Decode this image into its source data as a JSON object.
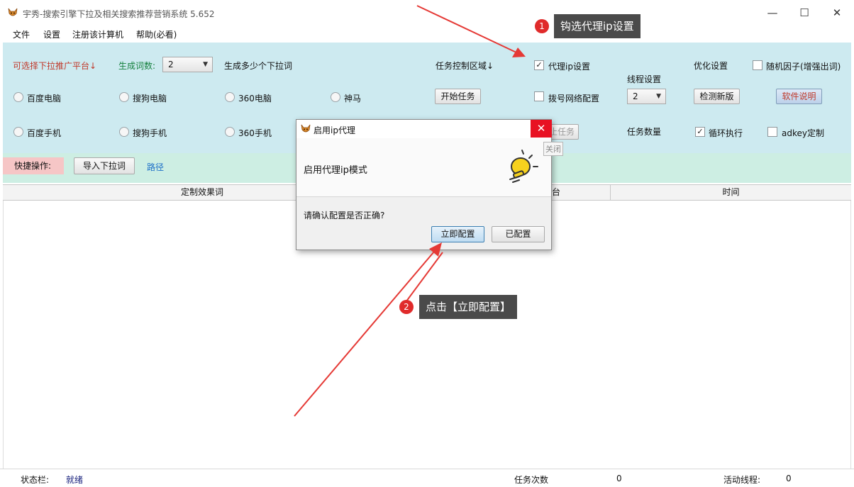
{
  "window": {
    "title": "宇秀-搜索引擎下拉及相关搜索推荐营销系统 5.652",
    "minimize": "—",
    "maximize": "☐",
    "close": "✕"
  },
  "menu": [
    "文件",
    "设置",
    "注册该计算机",
    "帮助(必看)"
  ],
  "panel": {
    "platform_label": "可选择下拉推广平台↓",
    "word_count_label": "生成词数:",
    "word_count_value": "2",
    "word_count_hint": "生成多少个下拉词",
    "task_area_label": "任务控制区域↓",
    "proxy_ip_label": "代理ip设置",
    "proxy_ip_checked": true,
    "thread_label": "线程设置",
    "thread_value": "2",
    "optimize_label": "优化设置",
    "random_factor_label": "随机因子(增强出词)",
    "random_factor_checked": false,
    "platforms_row1": [
      "百度电脑",
      "搜狗电脑",
      "360电脑",
      "神马"
    ],
    "platforms_row2": [
      "百度手机",
      "搜狗手机",
      "360手机"
    ],
    "start_task": "开始任务",
    "stop_task_partial": "止任务",
    "dialup_label": "拨号网络配置",
    "dialup_checked": false,
    "check_version": "检测新版",
    "software_help": "软件说明",
    "task_count_label": "任务数量",
    "loop_label": "循环执行",
    "loop_checked": true,
    "adkey_label": "adkey定制",
    "adkey_checked": false
  },
  "quick": {
    "label": "快捷操作:",
    "import_button": "导入下拉词",
    "path_link": "路径"
  },
  "table": {
    "columns": [
      "定制效果词",
      "台",
      "时间"
    ]
  },
  "status": {
    "label": "状态栏:",
    "value": "就绪",
    "task_times_label": "任务次数",
    "task_times_value": "0",
    "active_threads_label": "活动线程:",
    "active_threads_value": "0"
  },
  "dialog": {
    "title": "启用ip代理",
    "message": "启用代理ip模式",
    "question": "请确认配置是否正确?",
    "configure_now": "立即配置",
    "configured": "已配置",
    "close": "✕",
    "close_tooltip": "关闭"
  },
  "annotations": [
    {
      "badge": "1",
      "text": "钩选代理ip设置"
    },
    {
      "badge": "2",
      "text": "点击【立即配置】"
    }
  ],
  "colors": {
    "panel_bg": "#cdeaf0",
    "quick_bg": "#cdeee3",
    "arrow": "#e53935",
    "callout_bg": "#4a4a4a",
    "close_red": "#e81123"
  }
}
